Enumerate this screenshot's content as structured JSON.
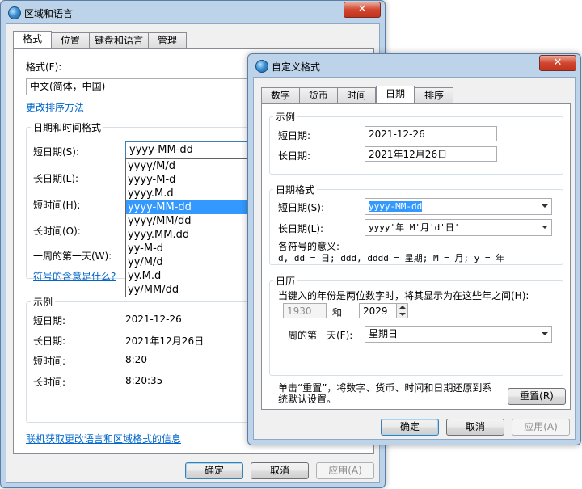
{
  "main": {
    "title": "区域和语言",
    "close": "✕",
    "tabs": [
      "格式",
      "位置",
      "键盘和语言",
      "管理"
    ],
    "format_label": "格式(F):",
    "format_value": "中文(简体，中国)",
    "change_sort": "更改排序方法",
    "datetime_group": "日期和时间格式",
    "short_date_label": "短日期(S):",
    "short_date_value": "yyyy-MM-dd",
    "long_date_label": "长日期(L):",
    "short_time_label": "短时间(H):",
    "long_time_label": "长时间(O):",
    "first_day_label": "一周的第一天(W):",
    "symbols_link": "符号的含意是什么?",
    "dropdown_items": [
      "yyyy/M/d",
      "yyyy-M-d",
      "yyyy.M.d",
      "yyyy-MM-dd",
      "yyyy/MM/dd",
      "yyyy.MM.dd",
      "yy-M-d",
      "yy/M/d",
      "yy.M.d",
      "yy/MM/dd"
    ],
    "dropdown_selected_index": 3,
    "example_group": "示例",
    "examples": [
      {
        "label": "短日期:",
        "value": "2021-12-26"
      },
      {
        "label": "长日期:",
        "value": "2021年12月26日"
      },
      {
        "label": "短时间:",
        "value": "8:20"
      },
      {
        "label": "长时间:",
        "value": "8:20:35"
      }
    ],
    "online_link": "联机获取更改语言和区域格式的信息",
    "ok": "确定",
    "cancel": "取消",
    "apply": "应用(A)"
  },
  "custom": {
    "title": "自定义格式",
    "close": "✕",
    "tabs": [
      "数字",
      "货币",
      "时间",
      "日期",
      "排序"
    ],
    "example_group": "示例",
    "ex_short_label": "短日期:",
    "ex_short_value": "2021-12-26",
    "ex_long_label": "长日期:",
    "ex_long_value": "2021年12月26日",
    "format_group": "日期格式",
    "fmt_short_label": "短日期(S):",
    "fmt_short_value": "yyyy-MM-dd",
    "fmt_long_label": "长日期(L):",
    "fmt_long_value": "yyyy'年'M'月'd'日'",
    "symbols_title": "各符号的意义:",
    "symbols_line": "d, dd = 日;  ddd, dddd = 星期;  M = 月;  y = 年",
    "calendar_group": "日历",
    "calendar_text": "当键入的年份是两位数字时，将其显示为在这些年之间(H):",
    "year_from": "1930",
    "and": "和",
    "year_to": "2029",
    "first_day_label": "一周的第一天(F):",
    "first_day_value": "星期日",
    "reset_text": "单击“重置”，将数字、货币、时间和日期还原到系统默认设置。",
    "reset_btn": "重置(R)",
    "ok": "确定",
    "cancel": "取消",
    "apply": "应用(A)"
  }
}
